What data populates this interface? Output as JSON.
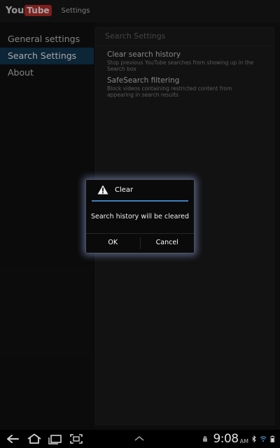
{
  "action_bar": {
    "logo_you": "You",
    "logo_tube": "Tube",
    "title": "Settings"
  },
  "sidebar": {
    "items": [
      {
        "label": "General settings",
        "selected": false
      },
      {
        "label": "Search Settings",
        "selected": true
      },
      {
        "label": "About",
        "selected": false
      }
    ]
  },
  "panel": {
    "header": "Search Settings",
    "prefs": [
      {
        "title": "Clear search history",
        "summary": "Stop previous YouTube searches from showing up in the Search box"
      },
      {
        "title": "SafeSearch filtering",
        "summary": "Block videos containing restricted content from appearing in search results"
      }
    ]
  },
  "dialog": {
    "icon": "warning-icon",
    "title": "Clear",
    "message": "Search history will be cleared",
    "ok_label": "OK",
    "cancel_label": "Cancel"
  },
  "system_bar": {
    "nav_icons": [
      "back-icon",
      "home-icon",
      "recent-apps-icon",
      "screenshot-icon"
    ],
    "clock": "9:08",
    "ampm": "AM"
  },
  "colors": {
    "accent": "#3f7fc0",
    "selected_bg": "#133a55",
    "youtube_red": "#c4302b"
  }
}
